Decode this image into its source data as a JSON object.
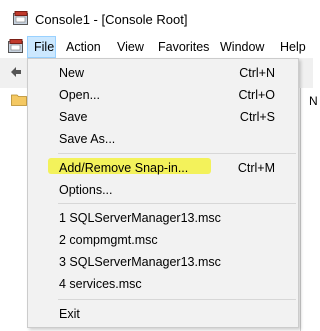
{
  "window": {
    "title": "Console1 - [Console Root]"
  },
  "menubar": {
    "items": [
      {
        "label": "File",
        "active": true
      },
      {
        "label": "Action"
      },
      {
        "label": "View"
      },
      {
        "label": "Favorites"
      },
      {
        "label": "Window"
      },
      {
        "label": "Help"
      }
    ]
  },
  "content": {
    "right_pane_text": "N"
  },
  "file_menu": {
    "items": [
      {
        "label": "New",
        "shortcut": "Ctrl+N"
      },
      {
        "label": "Open...",
        "shortcut": "Ctrl+O"
      },
      {
        "label": "Save",
        "shortcut": "Ctrl+S"
      },
      {
        "label": "Save As..."
      },
      {
        "label": "Add/Remove Snap-in...",
        "shortcut": "Ctrl+M",
        "highlighted": true
      },
      {
        "label": "Options..."
      },
      {
        "label": "1 SQLServerManager13.msc"
      },
      {
        "label": "2 compmgmt.msc"
      },
      {
        "label": "3 SQLServerManager13.msc"
      },
      {
        "label": "4 services.msc"
      },
      {
        "label": "Exit"
      }
    ]
  },
  "colors": {
    "highlight_marker": "#f3f24a",
    "active_menu_bg": "#cce8ff",
    "menu_bg": "#f2f2f2"
  },
  "icons": [
    "mmc-console-icon",
    "back-arrow-icon",
    "folder-icon"
  ]
}
